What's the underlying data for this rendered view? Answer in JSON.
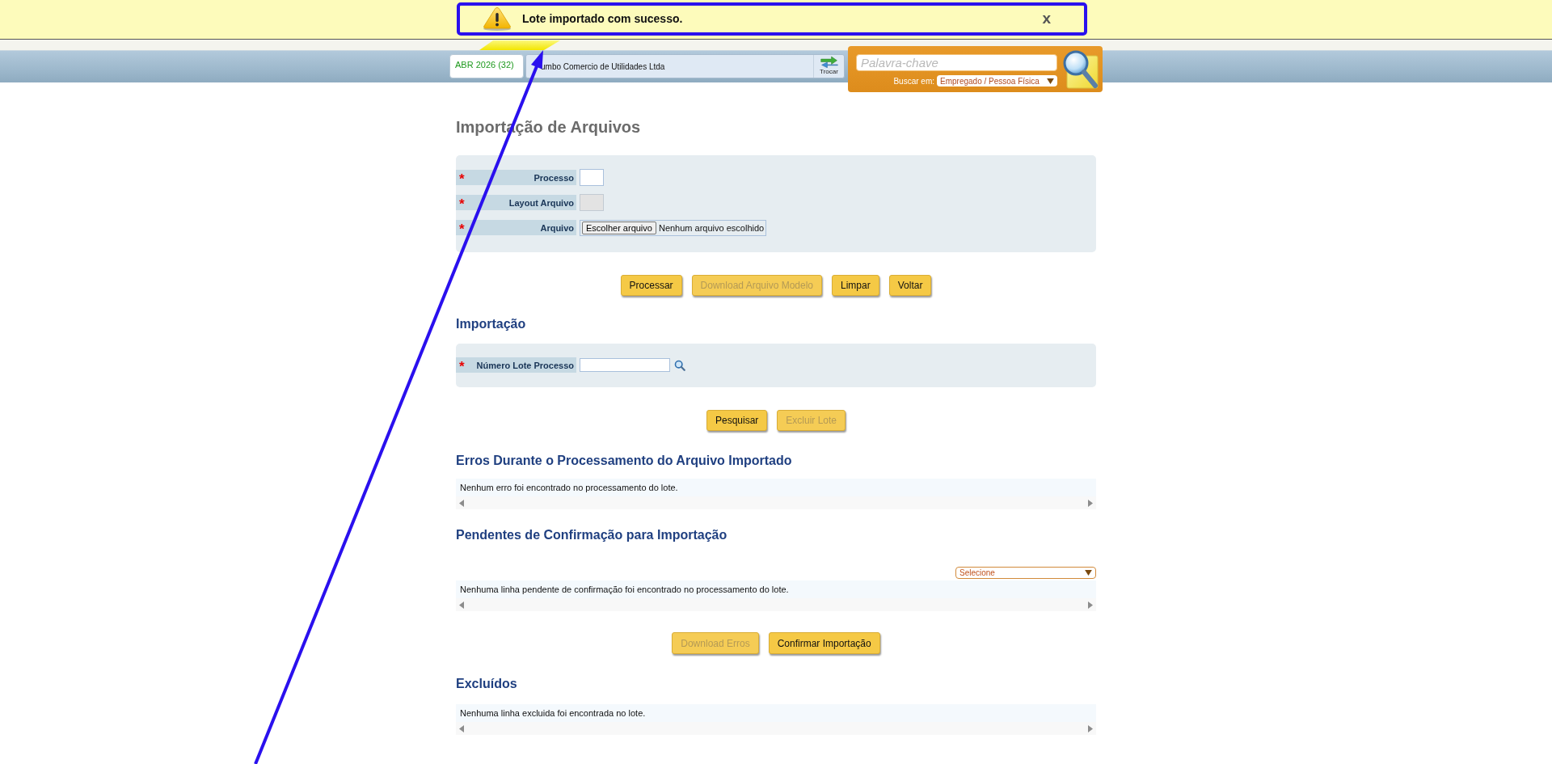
{
  "notification": {
    "message": "Lote importado com sucesso.",
    "close": "x"
  },
  "header": {
    "period": "ABR 2026 (32)",
    "company": "umbo Comercio de Utilidades Ltda",
    "switch_label": "Trocar",
    "search": {
      "placeholder": "Palavra-chave",
      "scope_label": "Buscar em:",
      "scope_value": "Empregado / Pessoa Física"
    }
  },
  "page_title": "Importação de Arquivos",
  "file_form": {
    "fields": [
      {
        "label": "Processo",
        "required_mark": "*",
        "kind": "text",
        "disabled": false
      },
      {
        "label": "Layout Arquivo",
        "required_mark": "*",
        "kind": "text",
        "disabled": true
      },
      {
        "label": "Arquivo",
        "required_mark": "*",
        "kind": "file",
        "button": "Escolher arquivo",
        "status": "Nenhum arquivo escolhido"
      }
    ],
    "actions": [
      {
        "label": "Processar",
        "disabled": false
      },
      {
        "label": "Download Arquivo Modelo",
        "disabled": true
      },
      {
        "label": "Limpar",
        "disabled": false
      },
      {
        "label": "Voltar",
        "disabled": false
      }
    ]
  },
  "import": {
    "title": "Importação",
    "fields": [
      {
        "label": "Número Lote Processo",
        "required_mark": "*",
        "kind": "lookup",
        "disabled": false
      }
    ],
    "actions": [
      {
        "label": "Pesquisar",
        "disabled": false
      },
      {
        "label": "Excluir Lote",
        "disabled": true
      }
    ]
  },
  "results": [
    {
      "title": "Erros Durante o Processamento do Arquivo Importado",
      "message": "Nenhum erro foi encontrado no processamento do lote."
    },
    {
      "title": "Pendentes de Confirmação para Importação",
      "filter": "Selecione",
      "message": "Nenhuma linha pendente de confirmação foi encontrado no processamento do lote.",
      "actions": [
        {
          "label": "Download Erros",
          "disabled": true
        },
        {
          "label": "Confirmar Importação",
          "disabled": false
        }
      ]
    },
    {
      "title": "Excluídos",
      "message": "Nenhuma linha excluida foi encontrada no lote."
    }
  ]
}
